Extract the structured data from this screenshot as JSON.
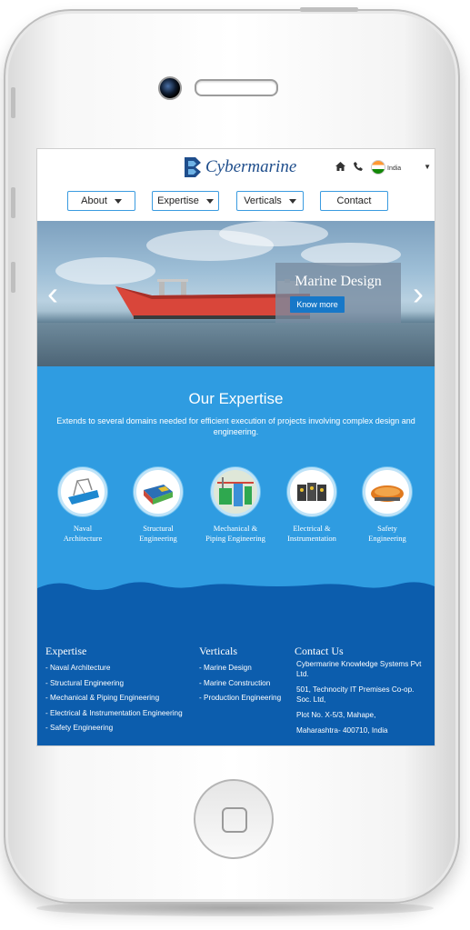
{
  "header": {
    "logo_text": "Cybermarine",
    "country": "India",
    "icons": [
      "home-icon",
      "phone-icon",
      "flag-icon",
      "chevron-down-icon"
    ]
  },
  "nav": {
    "items": [
      {
        "label": "About",
        "dropdown": true
      },
      {
        "label": "Expertise",
        "dropdown": true
      },
      {
        "label": "Verticals",
        "dropdown": true
      },
      {
        "label": "Contact",
        "dropdown": false
      }
    ]
  },
  "hero": {
    "title": "Marine Design",
    "button": "Know more"
  },
  "expertise": {
    "title": "Our Expertise",
    "subtitle": "Extends to several domains needed for efficient execution of projects involving complex design and engineering.",
    "items": [
      {
        "label_line1": "Naval",
        "label_line2": "Architecture"
      },
      {
        "label_line1": "Structural",
        "label_line2": "Engineering"
      },
      {
        "label_line1": "Mechanical &",
        "label_line2": "Piping Engineering"
      },
      {
        "label_line1": "Electrical &",
        "label_line2": "Instrumentation"
      },
      {
        "label_line1": "Safety",
        "label_line2": "Engineering"
      }
    ]
  },
  "footer": {
    "expertise": {
      "title": "Expertise",
      "items": [
        "- Naval Architecture",
        "- Structural Engineering",
        "- Mechanical & Piping Engineering",
        "- Electrical & Instrumentation Engineering",
        "- Safety Engineering"
      ]
    },
    "verticals": {
      "title": "Verticals",
      "items": [
        "- Marine Design",
        "- Marine Construction",
        "- Production Engineering"
      ]
    },
    "contact": {
      "title": "Contact Us",
      "company": "Cybermarine Knowledge Systems Pvt Ltd.",
      "address1": "501, Technocity IT Premises Co-op. Soc. Ltd,",
      "address2": "Plot No. X-5/3, Mahape,",
      "address3": "Maharashtra- 400710, India"
    }
  },
  "colors": {
    "brand_blue": "#1f4e8c",
    "expertise_bg": "#2f9ce1",
    "footer_bg": "#0c5dad",
    "button_blue": "#1778c8"
  }
}
